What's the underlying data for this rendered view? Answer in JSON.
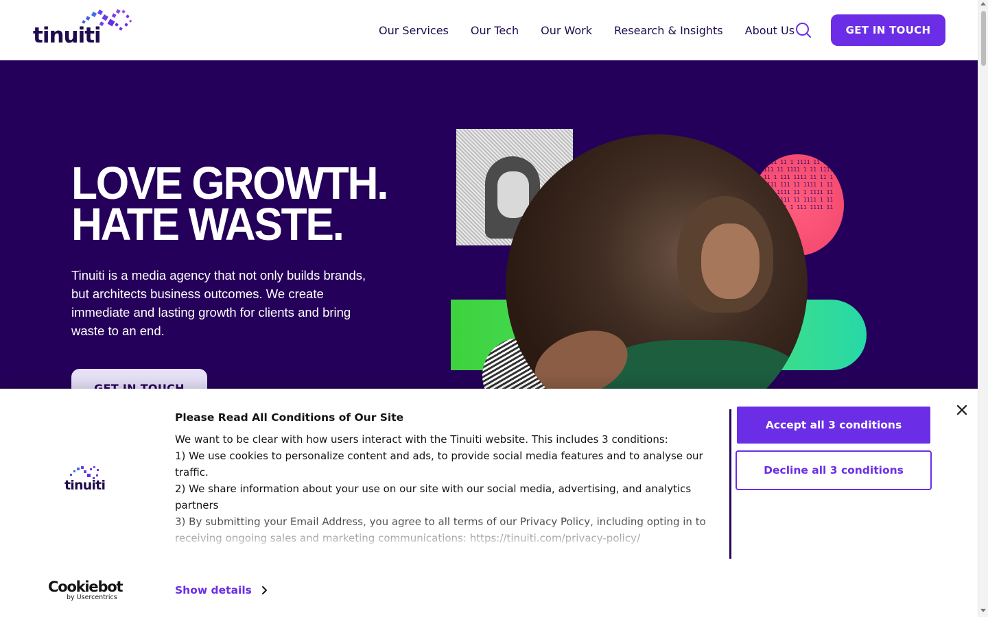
{
  "header": {
    "logo_text": "tinuiti",
    "nav": [
      {
        "label": "Our Services"
      },
      {
        "label": "Our Tech"
      },
      {
        "label": "Our Work"
      },
      {
        "label": "Research & Insights"
      },
      {
        "label": "About Us"
      }
    ],
    "search_icon": "search-icon",
    "cta_label": "GET IN TOUCH"
  },
  "hero": {
    "title_line1": "LOVE GROWTH.",
    "title_line2": "HATE WASTE.",
    "description": "Tinuiti is a media agency that not only builds brands, but architects business outcomes. We create immediate and lasting growth for clients and bring waste to an end.",
    "cta_label": "GET IN TOUCH",
    "pink_circle_pattern": "1111 11 1 1111 11 1111 111 11 1111 1 11 1111 11 1 111 1111 11 11 1 1111 111 11 1111 1 11 111 1111 11 1 1111 11 1111 111 11 1111 1 11 1111 11 1 111 1111 11"
  },
  "consent": {
    "logo_text": "tinuiti",
    "title": "Please Read All Conditions of Our Site",
    "intro": "We want to be clear with how users interact with the Tinuiti website. This includes 3 conditions:",
    "condition1": "1) We use cookies to personalize content and ads, to provide social media features and to analyse our traffic.",
    "condition2": "2) We share information about your use on our site with our social media, advertising, and analytics partners",
    "condition3": "3) By submitting your Email Address, you agree to all terms of our Privacy Policy, including opting in to receiving ongoing sales and marketing communications: https://tinuiti.com/privacy-policy/",
    "accept_label": "Accept all 3 conditions",
    "decline_label": "Decline all 3 conditions",
    "close_icon": "close-icon",
    "show_details_label": "Show details",
    "cookiebot_brand": "Cookiebot",
    "cookiebot_sub": "by Usercentrics"
  },
  "colors": {
    "brand_purple": "#6b2ee6",
    "hero_bg": "#25005a",
    "text_dark": "#1f0c4e"
  }
}
